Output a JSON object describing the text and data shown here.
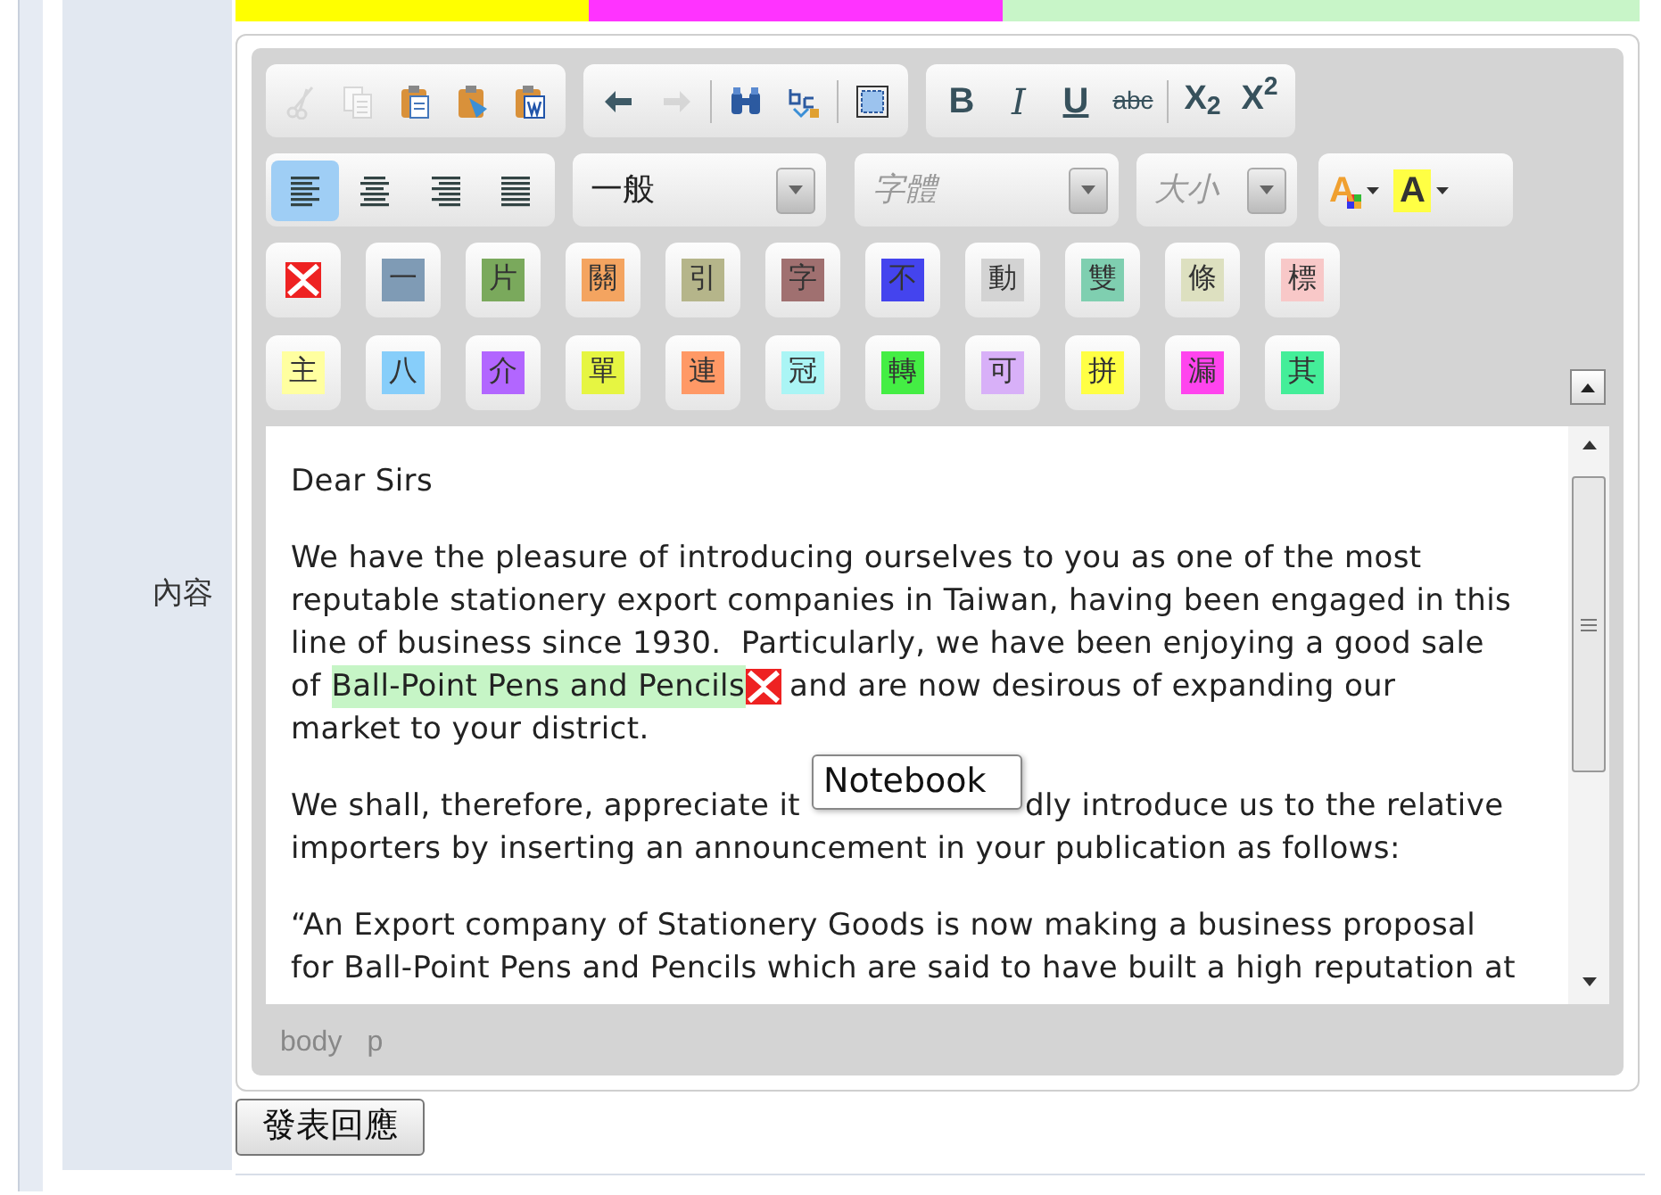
{
  "field_label": "內容",
  "toolbar": {
    "row_1": [
      {
        "subgroups": [
          [
            {
              "kind": "cut",
              "disabled": true
            },
            {
              "kind": "copy",
              "disabled": true
            },
            {
              "kind": "paste",
              "disabled": false
            },
            {
              "kind": "paste_text",
              "disabled": false
            },
            {
              "kind": "paste_word",
              "disabled": false
            }
          ]
        ]
      },
      {
        "subgroups": [
          [
            {
              "kind": "undo",
              "disabled": false
            },
            {
              "kind": "redo",
              "disabled": true
            }
          ],
          [
            {
              "kind": "find",
              "disabled": false
            },
            {
              "kind": "replace",
              "disabled": false
            }
          ],
          [
            {
              "kind": "maximize",
              "disabled": false
            }
          ]
        ]
      },
      {
        "subgroups": [
          [
            {
              "kind": "bold",
              "label": "B"
            },
            {
              "kind": "italic",
              "label": "I"
            },
            {
              "kind": "underline",
              "label": "U"
            },
            {
              "kind": "strike",
              "label": "abc"
            }
          ],
          [
            {
              "kind": "text",
              "label": "X$_{2}$"
            },
            {
              "kind": "text",
              "label": "X$^{2}$"
            }
          ]
        ]
      }
    ],
    "alignment": [
      {
        "kind": "left",
        "selected": true
      },
      {
        "kind": "center",
        "selected": false
      },
      {
        "kind": "right",
        "selected": false
      },
      {
        "kind": "justify",
        "selected": false
      }
    ],
    "format": {
      "value": "一般"
    },
    "font": {
      "placeholder": "字體"
    },
    "size": {
      "placeholder": "大小"
    },
    "colors": [
      {
        "kind": "text_color",
        "label": "A"
      },
      {
        "kind": "background_color",
        "label": "A"
      }
    ]
  },
  "chips": [
    [
      {
        "kind": "image"
      },
      {
        "kind": "char",
        "label": "一",
        "color": "#7f9bb5"
      },
      {
        "kind": "char",
        "label": "片",
        "color": "#7aa95c"
      },
      {
        "kind": "char",
        "label": "關",
        "color": "#f4a460"
      },
      {
        "kind": "char",
        "label": "引",
        "color": "#b5b58a"
      },
      {
        "kind": "char",
        "label": "字",
        "color": "#a07070"
      },
      {
        "kind": "char",
        "label": "不",
        "color": "#4444ee"
      },
      {
        "kind": "char",
        "label": "動",
        "color": "#d3d3d3"
      },
      {
        "kind": "char",
        "label": "雙",
        "color": "#7fcfb0"
      },
      {
        "kind": "char",
        "label": "條",
        "color": "#dde0c0"
      },
      {
        "kind": "char",
        "label": "標",
        "color": "#f8c8c8"
      }
    ],
    [
      {
        "kind": "char",
        "label": "主",
        "color": "#ffffa0"
      },
      {
        "kind": "char",
        "label": "八",
        "color": "#87cefa"
      },
      {
        "kind": "char",
        "label": "介",
        "color": "#b266ff"
      },
      {
        "kind": "char",
        "label": "單",
        "color": "#e6f542"
      },
      {
        "kind": "char",
        "label": "連",
        "color": "#ff9966"
      },
      {
        "kind": "char",
        "label": "冠",
        "color": "#aaf5f5"
      },
      {
        "kind": "char",
        "label": "轉",
        "color": "#44ee44"
      },
      {
        "kind": "char",
        "label": "可",
        "color": "#d8b0f8"
      },
      {
        "kind": "char",
        "label": "拼",
        "color": "#ffff44"
      },
      {
        "kind": "char",
        "label": "漏",
        "color": "#ff44ee"
      },
      {
        "kind": "char",
        "label": "其",
        "color": "#44ee99"
      }
    ]
  ],
  "content": [
    [
      [
        {
          "kind": "text",
          "text": "Dear Sirs",
          "highlight": false
        }
      ]
    ],
    [
      [
        {
          "kind": "text",
          "text": "We have the pleasure of introducing ourselves to you as one of the most",
          "highlight": false
        }
      ],
      [
        {
          "kind": "text",
          "text": "reputable stationery export companies in Taiwan, having been engaged in this",
          "highlight": false
        }
      ],
      [
        {
          "kind": "text",
          "text": "line of business since 1930.  Particularly, we have been enjoying a good sale",
          "highlight": false
        }
      ],
      [
        {
          "kind": "text",
          "text": "of",
          "highlight": false
        },
        {
          "kind": "text",
          "text": "Ball-Point Pens and Pencils",
          "highlight": true
        },
        {
          "kind": "image"
        },
        {
          "kind": "text",
          "text": "and are now desirous of expanding our",
          "highlight": false
        }
      ],
      [
        {
          "kind": "text",
          "text": "market to your district.",
          "highlight": false
        }
      ]
    ],
    [
      [
        {
          "kind": "text",
          "text": "We shall, therefore, appreciate it",
          "highlight": false
        },
        {
          "kind": "tooltip",
          "text": "Notebook"
        },
        {
          "kind": "text",
          "text": "dly introduce us to the relative",
          "highlight": false
        }
      ],
      [
        {
          "kind": "text",
          "text": "importers by inserting an announcement in your publication as follows:",
          "highlight": false
        }
      ]
    ],
    [
      [
        {
          "kind": "text",
          "text": "“An Export company of Stationery Goods is now making a business proposal",
          "highlight": false
        }
      ],
      [
        {
          "kind": "text",
          "text": "for Ball-Point Pens and Pencils which are said to have built a high reputation at",
          "highlight": false
        }
      ]
    ]
  ],
  "path": [
    "body",
    "p"
  ],
  "submit": "發表回應"
}
